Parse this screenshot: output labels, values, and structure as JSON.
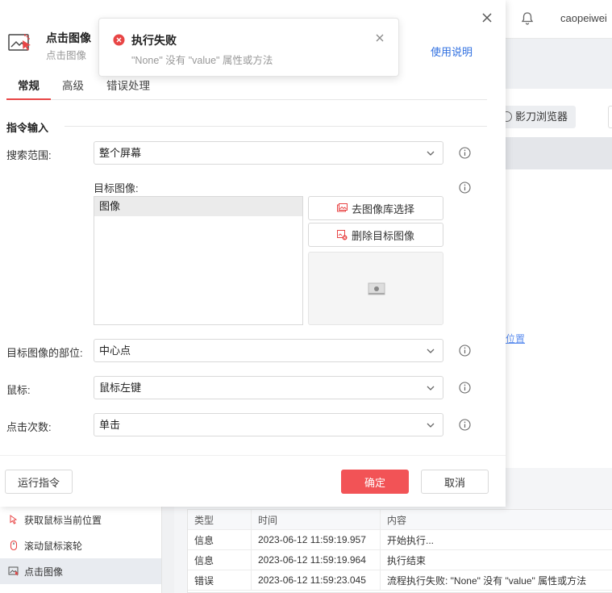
{
  "background": {
    "user_name": "caopeiwei",
    "browser_tab_label": "影刀浏览器",
    "link_fragment": "位置",
    "command_list": [
      {
        "label": "获取鼠标当前位置",
        "icon": "mouse-cursor-icon"
      },
      {
        "label": "滚动鼠标滚轮",
        "icon": "mouse-wheel-icon"
      },
      {
        "label": "点击图像",
        "icon": "click-image-icon"
      }
    ],
    "log": {
      "columns": [
        "类型",
        "时间",
        "内容"
      ],
      "rows": [
        {
          "type": "信息",
          "time": "2023-06-12 11:59:19.957",
          "content": "开始执行..."
        },
        {
          "type": "信息",
          "time": "2023-06-12 11:59:19.964",
          "content": "执行结束"
        },
        {
          "type": "错误",
          "time": "2023-06-12 11:59:23.045",
          "content": "流程执行失败: \"None\" 没有 \"value\" 属性或方法"
        }
      ]
    }
  },
  "dialog": {
    "title": "点击图像",
    "subtitle": "点击图像",
    "help_link": "使用说明",
    "tabs": [
      "常规",
      "高级",
      "错误处理"
    ],
    "active_tab": "常规",
    "section_title": "指令输入",
    "fields": {
      "search_range": {
        "label": "搜索范围:",
        "value": "整个屏幕"
      },
      "target_image": {
        "label": "目标图像:",
        "items": [
          "图像"
        ]
      },
      "target_part": {
        "label": "目标图像的部位:",
        "value": "中心点"
      },
      "mouse": {
        "label": "鼠标:",
        "value": "鼠标左键"
      },
      "click_count": {
        "label": "点击次数:",
        "value": "单击"
      }
    },
    "buttons": {
      "pick_from_library": "去图像库选择",
      "delete_target": "删除目标图像",
      "run": "运行指令",
      "ok": "确定",
      "cancel": "取消"
    }
  },
  "toast": {
    "title": "执行失败",
    "message": "\"None\" 没有 \"value\" 属性或方法"
  },
  "colors": {
    "accent": "#f25356",
    "link": "#2f6fe0",
    "error": "#e84545"
  }
}
